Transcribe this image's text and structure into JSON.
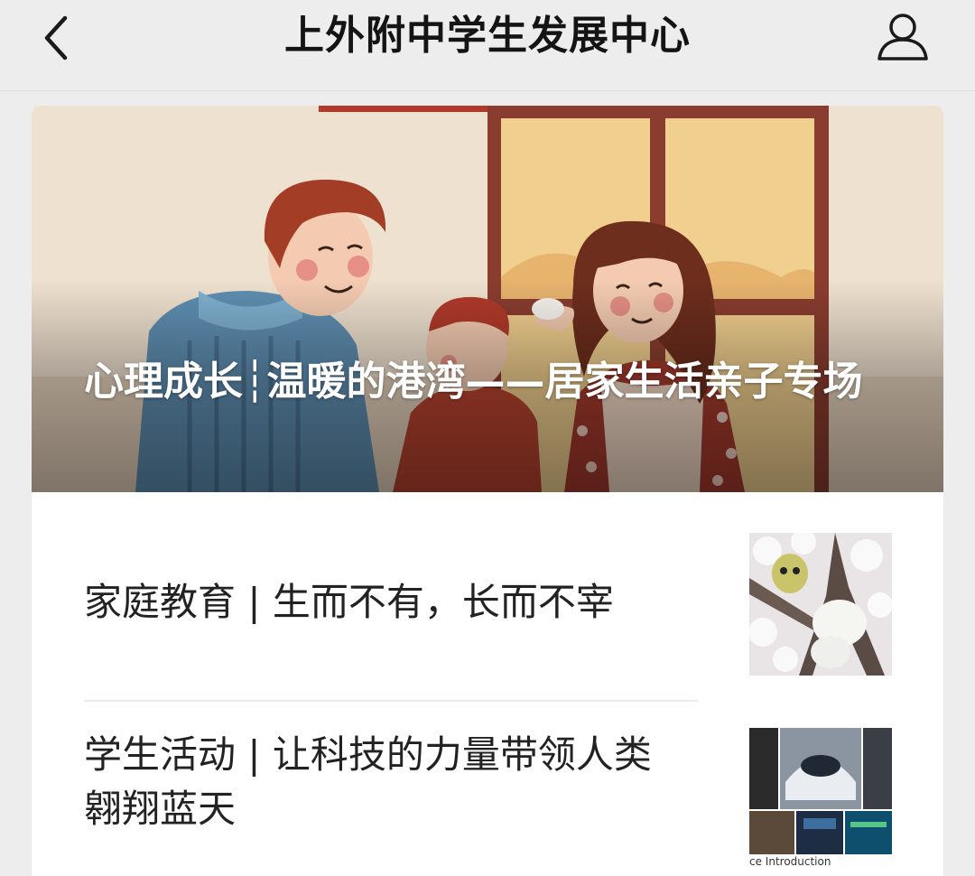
{
  "header": {
    "title": "上外附中学生发展中心",
    "back_icon": "chevron-left-icon",
    "profile_icon": "person-icon"
  },
  "hero": {
    "title": "心理成长┆温暖的港湾——居家生活亲子专场"
  },
  "articles": [
    {
      "title": "家庭教育 | 生而不有，长而不宰",
      "thumb_icon": "photo-icon"
    },
    {
      "title": "学生活动 | 让科技的力量带领人类翱翔蓝天",
      "thumb_icon": "photo-icon",
      "thumb_caption": "ce Introduction"
    }
  ],
  "colors": {
    "background": "#ededed",
    "card": "#ffffff",
    "text": "#222222"
  }
}
